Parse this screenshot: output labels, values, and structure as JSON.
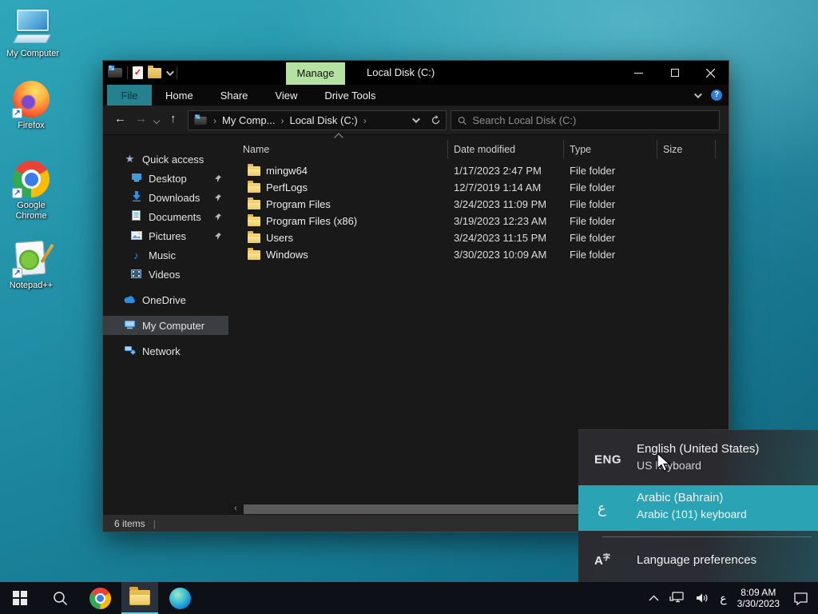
{
  "colors": {
    "accent_teal": "#26818f",
    "manage_green": "#b5e2a2",
    "highlight_teal": "#2aa4b5",
    "folder_yellow": "#e2b64e"
  },
  "desktop": {
    "icons": [
      {
        "label": "My Computer"
      },
      {
        "label": "Firefox"
      },
      {
        "label": "Google Chrome"
      },
      {
        "label": "Notepad++"
      }
    ]
  },
  "window": {
    "title": "Local Disk (C:)",
    "manage_label": "Manage",
    "controls": {
      "minimize": "—",
      "maximize": "▢",
      "close": "✕"
    },
    "ribbon_tabs": [
      "File",
      "Home",
      "Share",
      "View",
      "Drive Tools"
    ],
    "breadcrumb": {
      "root": "My Comp...",
      "current": "Local Disk (C:)",
      "sep": "›"
    },
    "search": {
      "placeholder": "Search Local Disk (C:)"
    },
    "sidebar": {
      "quick_access": "Quick access",
      "items": [
        {
          "label": "Desktop",
          "pinned": true
        },
        {
          "label": "Downloads",
          "pinned": true
        },
        {
          "label": "Documents",
          "pinned": true
        },
        {
          "label": "Pictures",
          "pinned": true
        },
        {
          "label": "Music",
          "pinned": false
        },
        {
          "label": "Videos",
          "pinned": false
        }
      ],
      "onedrive": "OneDrive",
      "my_computer": "My Computer",
      "network": "Network"
    },
    "columns": {
      "name": "Name",
      "date": "Date modified",
      "type": "Type",
      "size": "Size"
    },
    "files": [
      {
        "name": "mingw64",
        "date": "1/17/2023 2:47 PM",
        "type": "File folder"
      },
      {
        "name": "PerfLogs",
        "date": "12/7/2019 1:14 AM",
        "type": "File folder"
      },
      {
        "name": "Program Files",
        "date": "3/24/2023 11:09 PM",
        "type": "File folder"
      },
      {
        "name": "Program Files (x86)",
        "date": "3/19/2023 12:23 AM",
        "type": "File folder"
      },
      {
        "name": "Users",
        "date": "3/24/2023 11:15 PM",
        "type": "File folder"
      },
      {
        "name": "Windows",
        "date": "3/30/2023 10:09 AM",
        "type": "File folder"
      }
    ],
    "status": {
      "items_count": "6 items",
      "separator": "|"
    },
    "scroll_left_arrow": "‹"
  },
  "lang_popup": {
    "options": [
      {
        "badge": "ENG",
        "title": "English (United States)",
        "subtitle": "US keyboard"
      },
      {
        "badge": "ع",
        "title": "Arabic (Bahrain)",
        "subtitle": "Arabic (101) keyboard"
      }
    ],
    "preferences": {
      "icon_text": "A",
      "icon_sup": "字",
      "label": "Language preferences"
    }
  },
  "taskbar": {
    "tray": {
      "lang_indicator": "ع",
      "time": "8:09 AM",
      "date": "3/30/2023"
    }
  }
}
